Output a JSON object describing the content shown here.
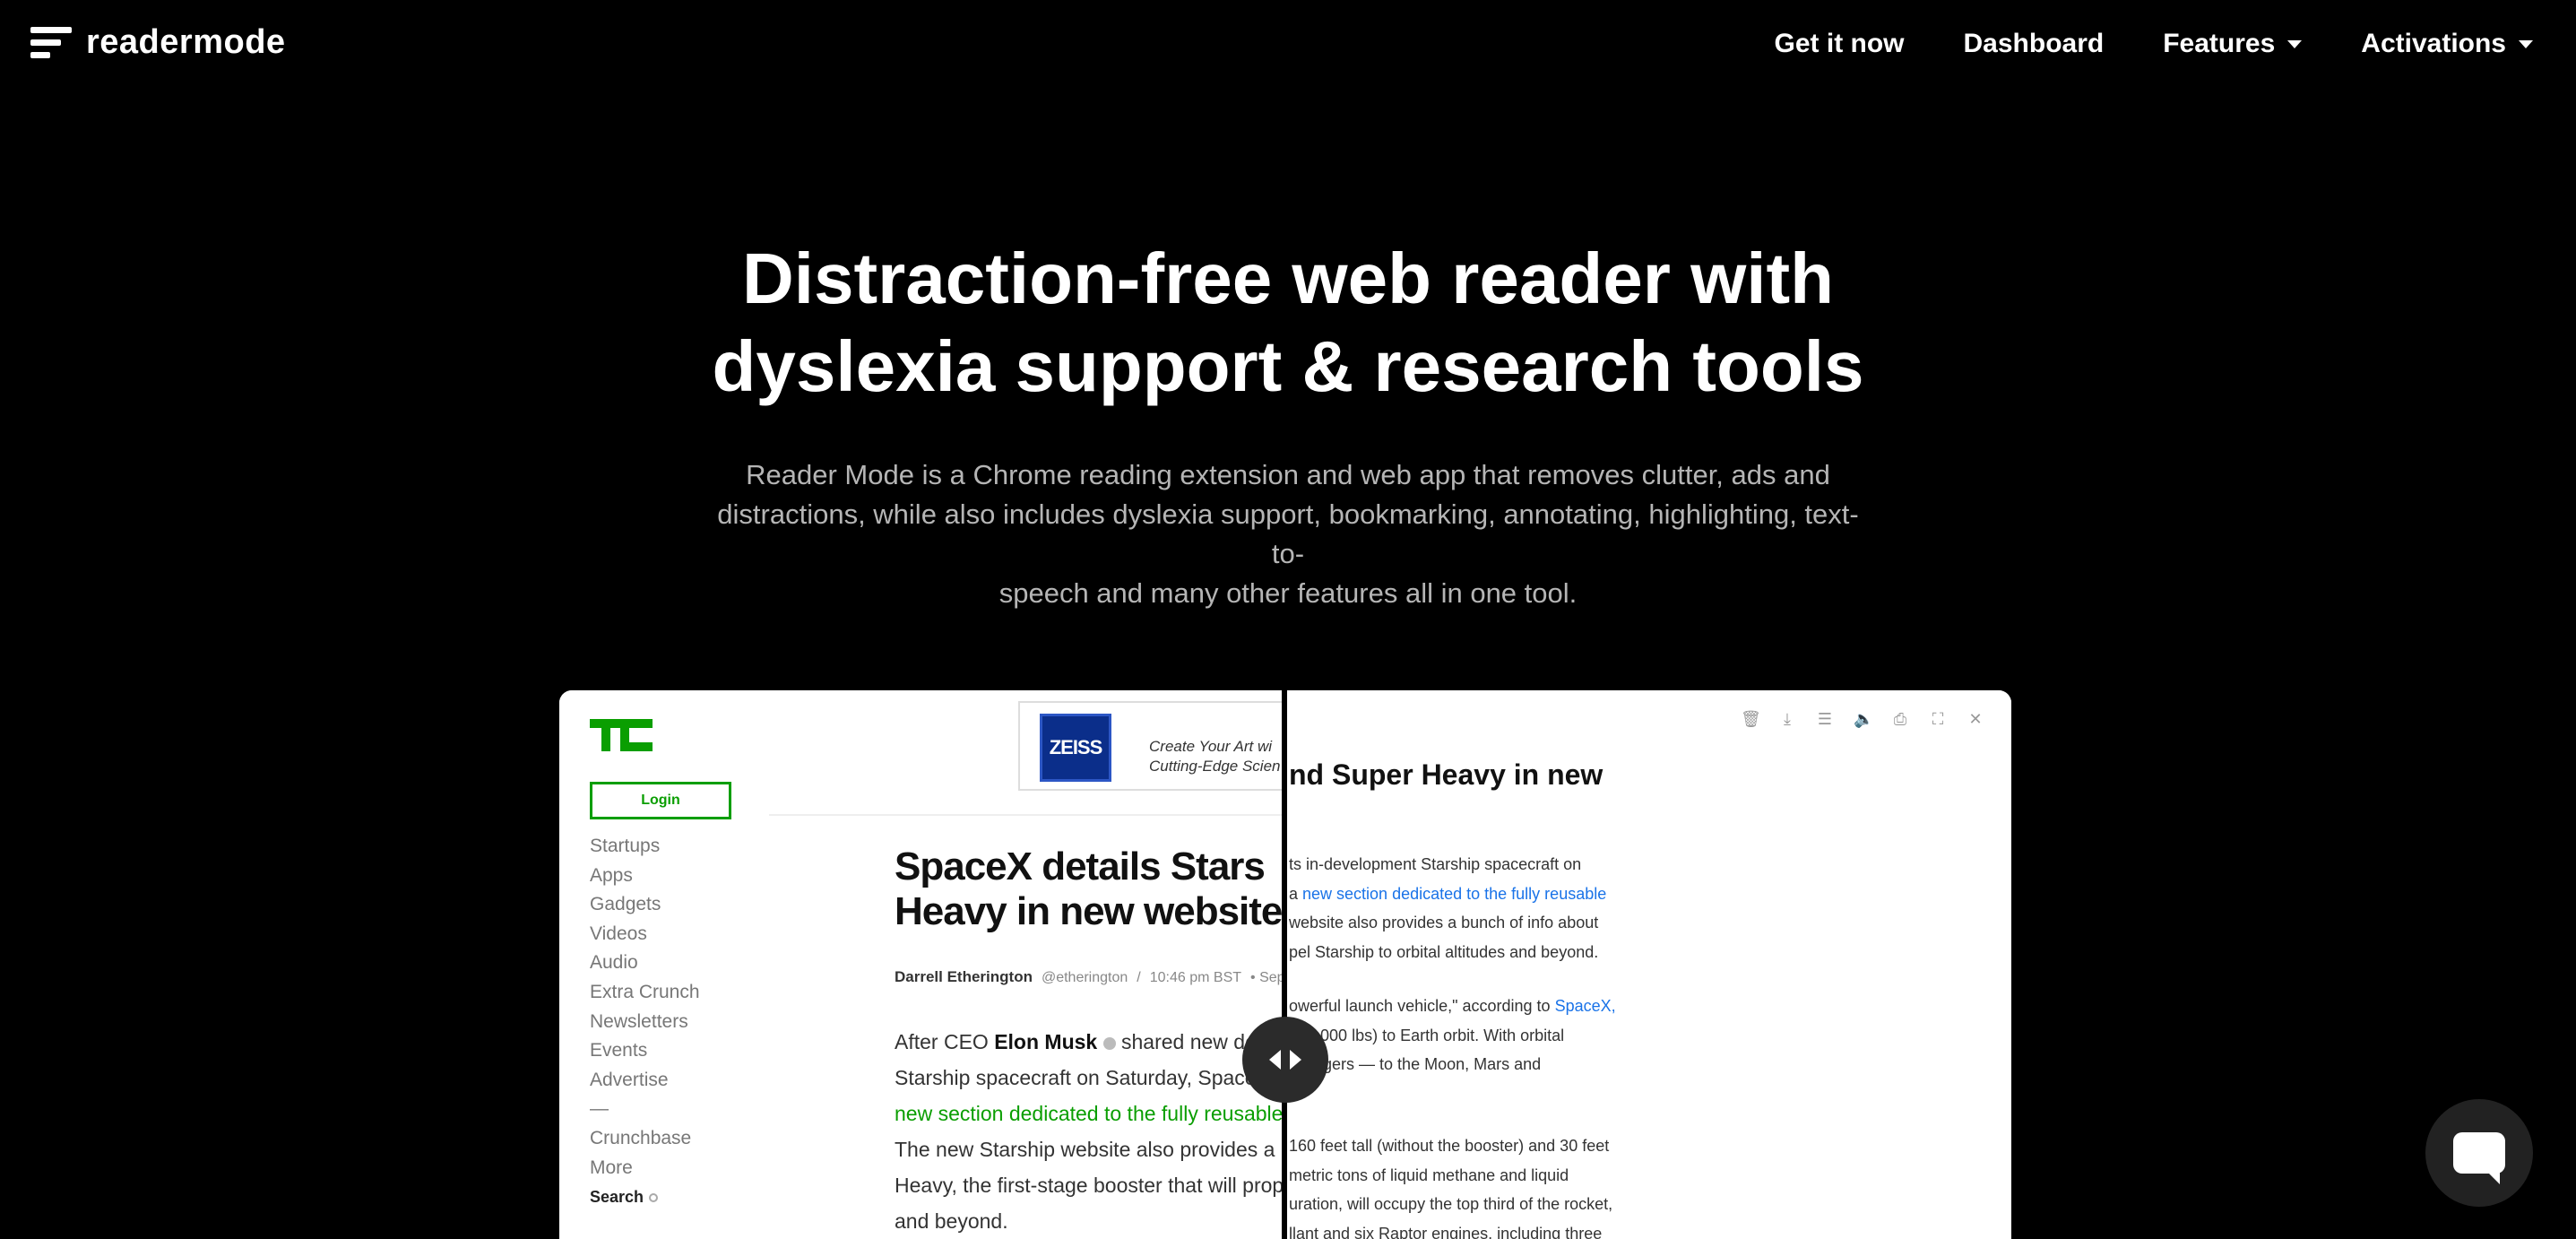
{
  "brand": {
    "name": "readermode",
    "icon": "readermode-logo-icon"
  },
  "nav": {
    "items": [
      {
        "label": "Get it now",
        "dropdown": false
      },
      {
        "label": "Dashboard",
        "dropdown": false
      },
      {
        "label": "Features",
        "dropdown": true
      },
      {
        "label": "Activations",
        "dropdown": true
      }
    ]
  },
  "hero": {
    "title_line1": "Distraction-free web reader with",
    "title_line2": "dyslexia support & research tools",
    "subtitle_line1": "Reader Mode is a Chrome reading extension and web app that removes clutter, ads and",
    "subtitle_line2": "distractions, while also includes dyslexia support, bookmarking, annotating, highlighting, text-to-",
    "subtitle_line3": "speech and many other features all in one tool."
  },
  "preview": {
    "left": {
      "login": "Login",
      "side_nav": [
        "Startups",
        "Apps",
        "Gadgets",
        "Videos",
        "Audio",
        "Extra Crunch",
        "Newsletters",
        "Events",
        "Advertise",
        "—",
        "Crunchbase",
        "More"
      ],
      "search": "Search",
      "ad_brand": "ZEISS",
      "ad_line1": "Create Your Art wi",
      "ad_line2": "Cutting-Edge Scien",
      "title_line1": "SpaceX details Stars",
      "title_line2": "Heavy in new website",
      "author": "Darrell Etherington",
      "handle": "@etherington",
      "sep": "/",
      "time": "10:46 pm BST",
      "date": "• Sep",
      "body_1a": "After CEO ",
      "body_1b": "Elon Musk",
      "body_1c": " shared new de",
      "body_2": "Starship spacecraft on Saturday, Space",
      "body_3": "new section dedicated to the fully reusable",
      "body_4": "The new Starship website also provides a b",
      "body_5": "Heavy, the first-stage booster that will prop",
      "body_6": "and beyond."
    },
    "right": {
      "title": "nd Super Heavy in new",
      "p1_l1": "ts in-development Starship spacecraft on",
      "p1_l2_pre": "a ",
      "p1_l2_link": "new section dedicated to the fully reusable",
      "p1_l3": "website also provides a bunch of info about",
      "p1_l4": "pel Starship to orbital altitudes and beyond.",
      "p2_l1_pre": "owerful launch vehicle,\" according to ",
      "p2_l1_link": "SpaceX,",
      "p2_l2": "220,000 lbs) to Earth orbit. With orbital",
      "p2_l3": "ssengers — to the Moon, Mars and",
      "p3_l1": "160 feet tall (without the booster) and 30 feet",
      "p3_l2": "metric tons of liquid methane and liquid",
      "p3_l3": "uration, will occupy the top third of the rocket,",
      "p3_l4": "llant and six Raptor engines, including three"
    },
    "toolbar_icons": [
      "trash-icon",
      "download-icon",
      "settings-sliders-icon",
      "speaker-icon",
      "print-icon",
      "fullscreen-icon",
      "close-icon"
    ]
  },
  "colors": {
    "background": "#000000",
    "accent_green": "#0a9e01",
    "link_blue": "#1a73e8"
  }
}
